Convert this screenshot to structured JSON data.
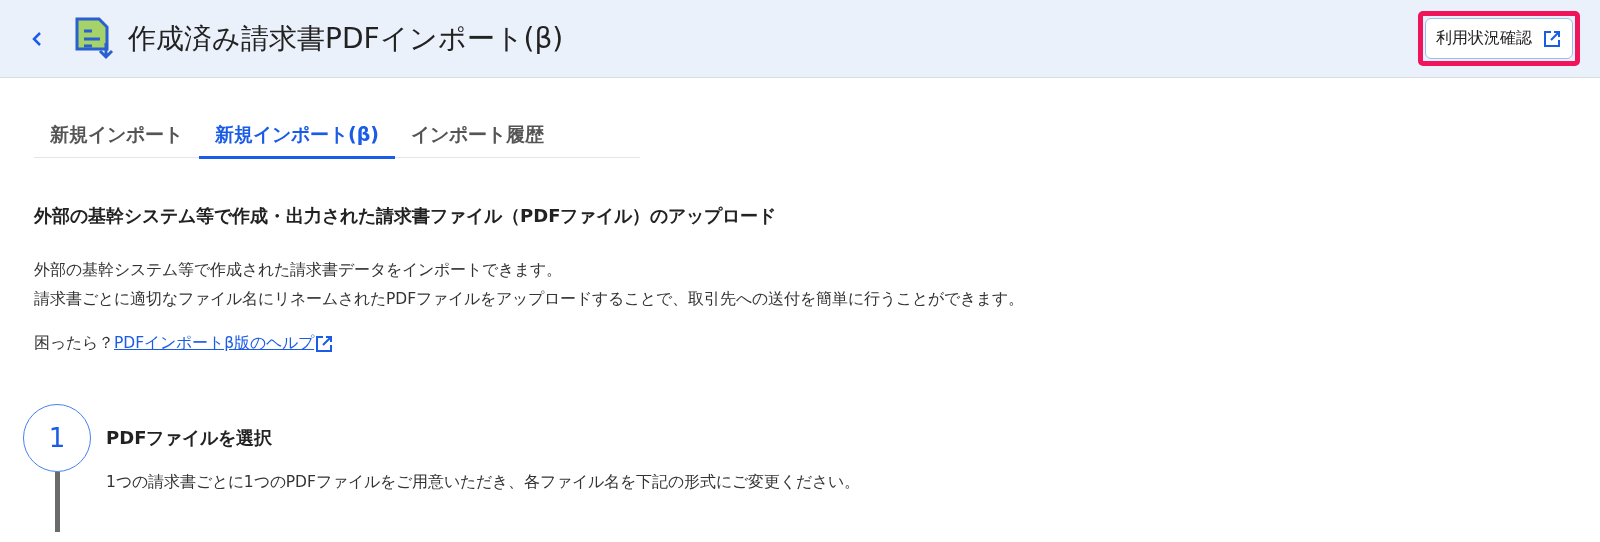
{
  "header": {
    "title": "作成済み請求書PDFインポート(β)",
    "usage_button": {
      "label": "利用状況確認",
      "highlighted": true
    }
  },
  "tabs": [
    {
      "label": "新規インポート",
      "selected": false
    },
    {
      "label": "新規インポート(β)",
      "selected": true
    },
    {
      "label": "インポート履歴",
      "selected": false
    }
  ],
  "section": {
    "heading": "外部の基幹システム等で作成・出力された請求書ファイル（PDFファイル）のアップロード",
    "paragraphs": [
      "外部の基幹システム等で作成された請求書データをインポートできます。",
      "請求書ごとに適切なファイル名にリネームされたPDFファイルをアップロードすることで、取引先への送付を簡単に行うことができます。"
    ],
    "help": {
      "prefix": "困ったら？",
      "link": "PDFインポートβ版のヘルプ"
    }
  },
  "steps": [
    {
      "number": "1",
      "title": "PDFファイルを選択",
      "description": "1つの請求書ごとに1つのPDFファイルをご用意いただき、各ファイル名を下記の形式にご変更ください。"
    }
  ]
}
